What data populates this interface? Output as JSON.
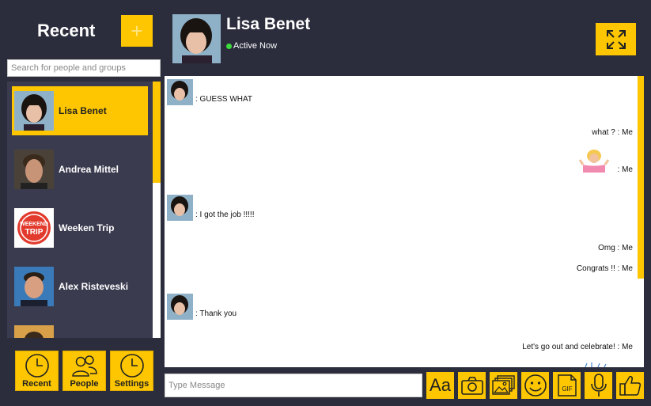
{
  "sidebar": {
    "title": "Recent",
    "add_label": "+",
    "search_placeholder": "Search for people and groups",
    "contacts": [
      {
        "name": "Lisa Benet",
        "active": true
      },
      {
        "name": "Andrea Mittel",
        "active": false
      },
      {
        "name": "Weeken Trip",
        "active": false
      },
      {
        "name": "Alex Risteveski",
        "active": false
      }
    ],
    "weekend_badge": {
      "top": "WEEKEND",
      "bottom": "TRIP"
    }
  },
  "nav": {
    "recent": "Recent",
    "people": "People",
    "settings": "Settings"
  },
  "header": {
    "name": "Lisa Benet",
    "status": "Active Now"
  },
  "messages": [
    {
      "side": "left",
      "text": ": GUESS WHAT"
    },
    {
      "side": "right",
      "text": "what ? : Me"
    },
    {
      "side": "right",
      "text": ": Me",
      "emoji": "person-shrugging"
    },
    {
      "side": "left",
      "text": ": I got the job !!!!!"
    },
    {
      "side": "right",
      "text": "Omg : Me"
    },
    {
      "side": "right",
      "text": "Congrats !! : Me"
    },
    {
      "side": "left",
      "text": ": Thank you"
    },
    {
      "side": "right",
      "text": "Let's go out and celebrate! : Me"
    }
  ],
  "composer": {
    "placeholder": "Type Message",
    "font_label": "Aa",
    "gif_label": "GIF"
  },
  "colors": {
    "accent": "#fdc600",
    "background": "#2b2d3c",
    "panel": "#3a3b4f",
    "online": "#3ddc3d"
  }
}
